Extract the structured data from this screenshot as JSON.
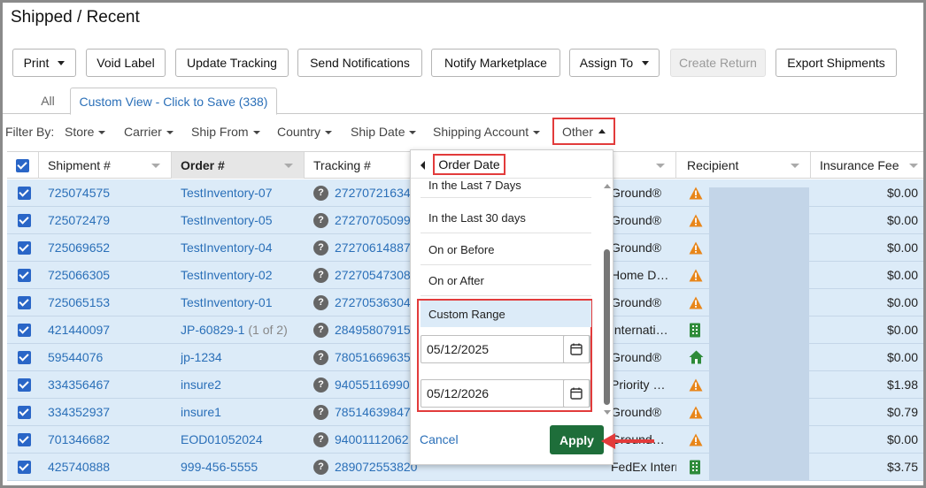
{
  "page": {
    "title": "Shipped / Recent"
  },
  "toolbar": {
    "print": "Print",
    "void_label": "Void Label",
    "update_tracking": "Update Tracking",
    "send_notifications": "Send Notifications",
    "notify_marketplace": "Notify Marketplace",
    "assign_to": "Assign To",
    "create_return": "Create Return",
    "export_shipments": "Export Shipments"
  },
  "tabs": {
    "all": "All",
    "custom": "Custom View - Click to Save (338)"
  },
  "filters": {
    "label": "Filter By:",
    "store": "Store",
    "carrier": "Carrier",
    "ship_from": "Ship From",
    "country": "Country",
    "ship_date": "Ship Date",
    "shipping_account": "Shipping Account",
    "other": "Other"
  },
  "table": {
    "headers": {
      "shipment": "Shipment #",
      "order": "Order #",
      "tracking": "Tracking #",
      "recipient": "Recipient",
      "insurance": "Insurance Fee"
    },
    "rows": [
      {
        "shipment": "725074575",
        "order": "TestInventory-07",
        "order_suffix": "",
        "tracking": "27270721634",
        "service": "Ground®",
        "status": "warning",
        "insurance": "$0.00"
      },
      {
        "shipment": "725072479",
        "order": "TestInventory-05",
        "order_suffix": "",
        "tracking": "27270705099",
        "service": "Ground®",
        "status": "warning",
        "insurance": "$0.00"
      },
      {
        "shipment": "725069652",
        "order": "TestInventory-04",
        "order_suffix": "",
        "tracking": "27270614887",
        "service": "Ground®",
        "status": "warning",
        "insurance": "$0.00"
      },
      {
        "shipment": "725066305",
        "order": "TestInventory-02",
        "order_suffix": "",
        "tracking": "27270547308",
        "service": "Home D…",
        "status": "warning",
        "insurance": "$0.00"
      },
      {
        "shipment": "725065153",
        "order": "TestInventory-01",
        "order_suffix": "",
        "tracking": "27270536304",
        "service": "Ground®",
        "status": "warning",
        "insurance": "$0.00"
      },
      {
        "shipment": "421440097",
        "order": "JP-60829-1",
        "order_suffix": "(1 of 2)",
        "tracking": "28495807915",
        "service": "Internati…",
        "status": "building",
        "insurance": "$0.00"
      },
      {
        "shipment": "59544076",
        "order": "jp-1234",
        "order_suffix": "",
        "tracking": "78051669635",
        "service": "Ground®",
        "status": "home",
        "insurance": "$0.00"
      },
      {
        "shipment": "334356467",
        "order": "insure2",
        "order_suffix": "",
        "tracking": "94055116990",
        "service": "Priority …",
        "status": "warning",
        "insurance": "$1.98"
      },
      {
        "shipment": "334352937",
        "order": "insure1",
        "order_suffix": "",
        "tracking": "78514639847",
        "service": "Ground®",
        "status": "warning",
        "insurance": "$0.79"
      },
      {
        "shipment": "701346682",
        "order": "EOD01052024",
        "order_suffix": "",
        "tracking": "94001112062",
        "service": "Ground…",
        "status": "warning",
        "insurance": "$0.00"
      },
      {
        "shipment": "425740888",
        "order": "999-456-5555",
        "order_suffix": "",
        "tracking": "289072553820",
        "service": "FedEx Internati…",
        "status": "building",
        "insurance": "$3.75"
      }
    ]
  },
  "dropdown": {
    "title": "Order Date",
    "items": [
      "In the Last 7 Days",
      "In the Last 30 days",
      "On or Before",
      "On or After"
    ],
    "custom_range": "Custom Range",
    "from_date": "05/12/2025",
    "to_date": "05/12/2026",
    "cancel": "Cancel",
    "apply": "Apply"
  },
  "colors": {
    "accent": "#2a6fb8",
    "row_selected": "#dcebf8",
    "apply_green": "#1e6e3a",
    "highlight_red": "#e23b3b",
    "warning_orange": "#e8861a",
    "status_green": "#2e8b3a"
  }
}
